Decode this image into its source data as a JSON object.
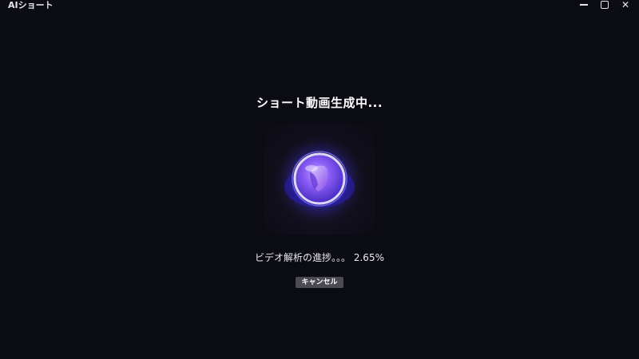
{
  "window": {
    "title": "AIショート",
    "controls": [
      "minimize-icon",
      "maximize-icon",
      "close-icon"
    ],
    "close_glyph": "✕"
  },
  "main": {
    "heading": "ショート動画生成中...",
    "preview_icon": "purple-orb-icon",
    "progress_label": "ビデオ解析の進捗。。。",
    "progress_value": "2.65%",
    "cancel_label": "キャンセル"
  },
  "colors": {
    "background": "#0b0b14",
    "orb": "#6b4cff",
    "button": "#4a4a52"
  }
}
